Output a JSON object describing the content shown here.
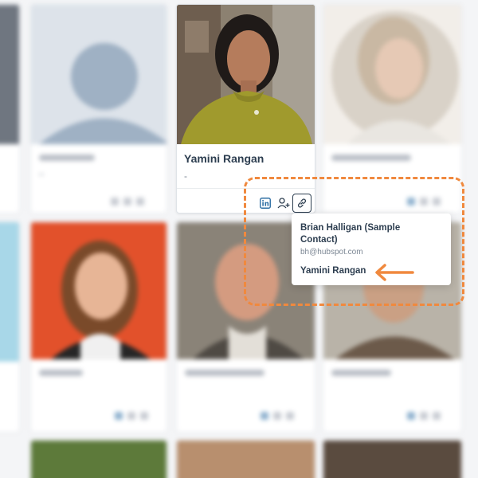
{
  "focused_card": {
    "name": "Yamini Rangan",
    "subtitle": "-"
  },
  "popover": {
    "contact_name": "Brian Halligan (Sample Contact)",
    "contact_email": "bh@hubspot.com",
    "option": "Yamini Rangan"
  },
  "colors": {
    "annotation": "#f0893e",
    "text_dark": "#2d3e50",
    "text_muted": "#7c8794"
  },
  "icons": [
    "linkedin-icon",
    "add-person-icon",
    "link-icon",
    "arrow-left-icon"
  ]
}
